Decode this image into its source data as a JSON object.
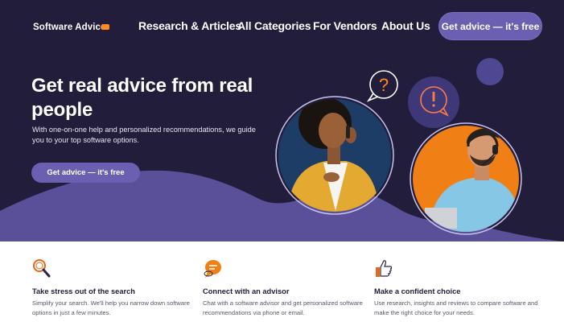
{
  "header": {
    "logo_text": "Software Advice.",
    "nav": [
      "Research & Articles",
      "All Categories",
      "For Vendors",
      "About Us"
    ],
    "cta_label": "Get advice — it's free"
  },
  "hero": {
    "title": "Get real advice from real people",
    "subtitle": "With one-on-one help and personalized recommendations, we guide you to your top software options.",
    "cta_label": "Get advice — it's free"
  },
  "features": [
    {
      "icon": "magnifier-icon",
      "title": "Take stress out of the search",
      "text": "Simplify your search. We'll help you narrow down software options in just a few minutes."
    },
    {
      "icon": "chat-bubble-icon",
      "title": "Connect with an advisor",
      "text": "Chat with a software advisor and get personalized software recommendations via phone or email."
    },
    {
      "icon": "thumbs-up-icon",
      "title": "Make a confident choice",
      "text": "Use research, insights and reviews to compare software and make the right choice for your needs."
    }
  ],
  "colors": {
    "hero_bg": "#211d3b",
    "accent_purple": "#6b5fb2",
    "accent_orange": "#ff8a1f"
  }
}
